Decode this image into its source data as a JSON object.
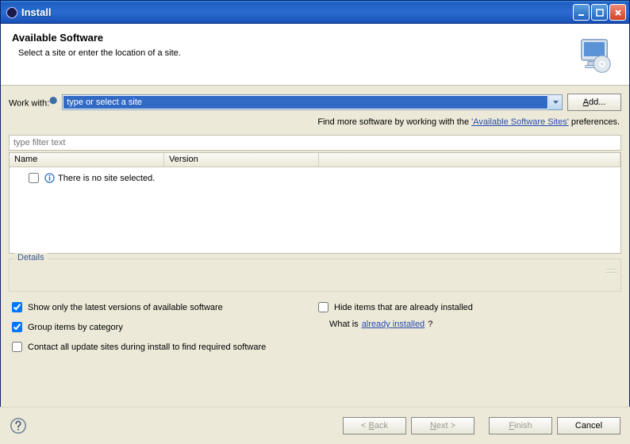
{
  "window": {
    "title": "Install"
  },
  "header": {
    "title": "Available Software",
    "subtitle": "Select a site or enter the location of a site."
  },
  "workwith": {
    "label": "Work with:",
    "placeholder": "type or select a site",
    "addBtn": "Add...",
    "findMorePre": "Find more software by working with the ",
    "findMoreLink": "'Available Software Sites'",
    "findMorePost": " preferences."
  },
  "filter": {
    "placeholder": "type filter text"
  },
  "table": {
    "cols": {
      "name": "Name",
      "version": "Version"
    },
    "emptyMsg": "There is no site selected."
  },
  "details": {
    "legend": "Details"
  },
  "options": {
    "showLatest": "Show only the latest versions of available software",
    "groupCategory": "Group items by category",
    "contactAll": "Contact all update sites during install to find required software",
    "hideInstalled": "Hide items that are already installed",
    "whatIsPre": "What is ",
    "whatIsLink": "already installed",
    "whatIsPost": "?"
  },
  "buttons": {
    "back": "< Back",
    "next": "Next >",
    "finish": "Finish",
    "cancel": "Cancel"
  }
}
